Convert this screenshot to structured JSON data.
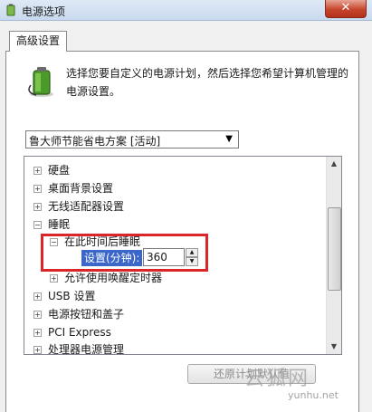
{
  "window": {
    "title": "电源选项",
    "close_glyph": "✕"
  },
  "tab": {
    "label": "高级设置"
  },
  "description": "选择您要自定义的电源计划，然后选择您希望计算机管理的电源设置。",
  "plan_select": {
    "value": "鲁大师节能省电方案 [活动]"
  },
  "tree": [
    {
      "label": "硬盘",
      "expander": "+"
    },
    {
      "label": "桌面背景设置",
      "expander": "+"
    },
    {
      "label": "无线适配器设置",
      "expander": "+"
    },
    {
      "label": "睡眠",
      "expander": "−"
    },
    {
      "label": "在此时间后睡眠",
      "expander": "−"
    },
    {
      "label": "允许使用唤醒定时器",
      "expander": "+"
    },
    {
      "label": "USB 设置",
      "expander": "+"
    },
    {
      "label": "电源按钮和盖子",
      "expander": "+"
    },
    {
      "label": "PCI Express",
      "expander": "+"
    },
    {
      "label": "处理器电源管理",
      "expander": "+"
    }
  ],
  "setting": {
    "label": "设置(分钟):",
    "value": "360"
  },
  "restore_button": {
    "label": "还原计划默认值"
  },
  "watermark": {
    "text": "云狐网",
    "url": "yunhu.net"
  },
  "colors": {
    "highlight_border": "#d9262b",
    "selection": "#3a67c9",
    "close": "#c7452d"
  }
}
